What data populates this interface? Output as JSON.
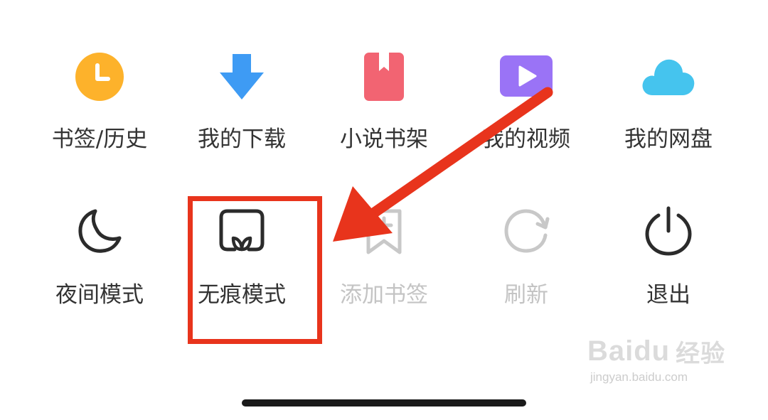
{
  "menu": {
    "row1": [
      {
        "label": "书签/历史",
        "icon": "clock-icon",
        "color": "#FDB22B"
      },
      {
        "label": "我的下载",
        "icon": "download-arrow-icon",
        "color": "#3E9BF4"
      },
      {
        "label": "小说书架",
        "icon": "bookmark-book-icon",
        "color": "#F26472"
      },
      {
        "label": "我的视频",
        "icon": "video-play-icon",
        "color": "#9A73F6"
      },
      {
        "label": "我的网盘",
        "icon": "cloud-icon",
        "color": "#45C4EE"
      }
    ],
    "row2": [
      {
        "label": "夜间模式",
        "icon": "moon-icon"
      },
      {
        "label": "无痕模式",
        "icon": "incognito-icon"
      },
      {
        "label": "添加书签",
        "icon": "add-bookmark-icon",
        "disabled": true
      },
      {
        "label": "刷新",
        "icon": "refresh-icon",
        "disabled": true
      },
      {
        "label": "退出",
        "icon": "power-icon"
      }
    ]
  },
  "annotation": {
    "highlight_color": "#E8341C",
    "arrow_color": "#E8341C"
  },
  "watermark": {
    "logo": "Baidu",
    "logo_cn": "经验",
    "url": "jingyan.baidu.com"
  }
}
